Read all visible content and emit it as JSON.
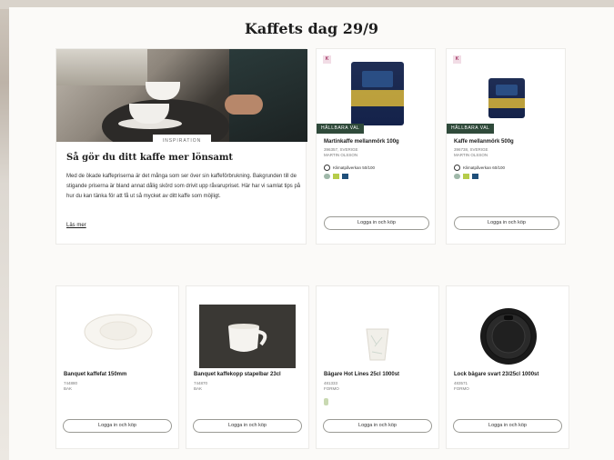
{
  "modal": {
    "title": "Kaffets dag 29/9"
  },
  "article": {
    "tag": "INSPIRATION",
    "title": "Så gör du ditt kaffe mer lönsamt",
    "body": "Med de ökade kaffepriserna är det många som ser över sin kaffeförbrukning. Bakgrunden till de stigande priserna är bland annat dålig skörd som drivit upp råvarupriset. Här har vi samlat tips på hur du kan tänka för att få ut så mycket av ditt kaffe som möjligt.",
    "read_more": "Läs mer"
  },
  "products": [
    {
      "badge": "K",
      "label": "HÅLLBARA VAL",
      "name": "Martinkaffe mellanmörk 100g",
      "meta1": "396357, SVERIGE",
      "meta2": "MARTIN OLSSON",
      "climate": "Klimatpåverkan 50/100",
      "button": "Logga in och köp",
      "image": "coffee-bag-icon"
    },
    {
      "badge": "K",
      "label": "HÅLLBARA VAL",
      "name": "Kaffe mellanmörk 500g",
      "meta1": "396738, SVERIGE",
      "meta2": "MARTIN OLSSON",
      "climate": "Klimatpåverkan 60/100",
      "button": "Logga in och köp",
      "image": "coffee-bag-icon"
    },
    {
      "name": "Banquet kaffefat 150mm",
      "meta1": "744880",
      "meta2": "BAK",
      "button": "Logga in och köp",
      "image": "saucer-icon"
    },
    {
      "name": "Banquet kaffekopp stapelbar 23cl",
      "meta1": "744870",
      "meta2": "BAK",
      "button": "Logga in och köp",
      "image": "cup-icon"
    },
    {
      "name": "Bägare Hot Lines 25cl 1000st",
      "meta1": "481333",
      "meta2": "FORMO",
      "button": "Logga in och köp",
      "image": "paper-cup-icon"
    },
    {
      "name": "Lock bägare svart 23/25cl 1000st",
      "meta1": "483571",
      "meta2": "FORMO",
      "button": "Logga in och köp",
      "image": "lid-icon"
    }
  ],
  "colors": {
    "green_label": "#2f4a3a",
    "badge_k_bg": "#f2dde6",
    "badge_k_text": "#a03060"
  }
}
